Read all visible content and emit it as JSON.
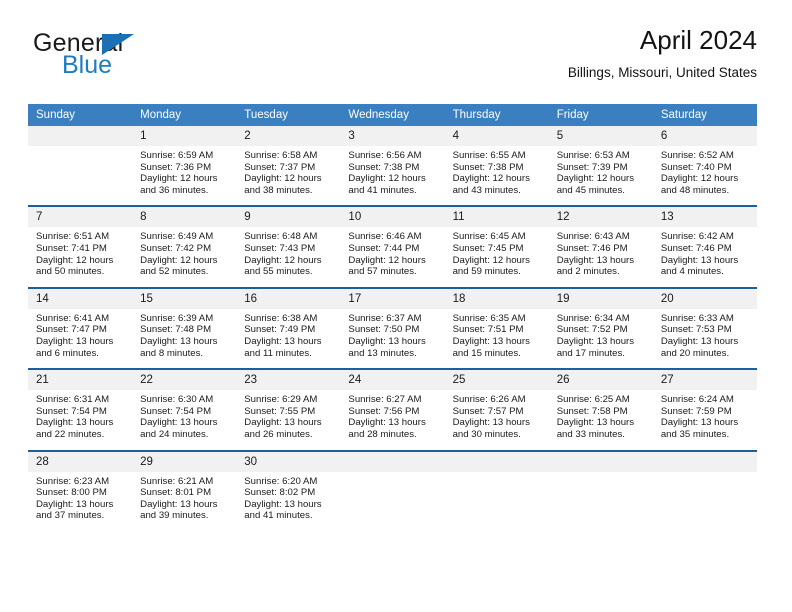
{
  "brand": {
    "name_top": "General",
    "name_bottom": "Blue",
    "triangle_color": "#1a6fb5",
    "blue_text_color": "#1c7cc1"
  },
  "header": {
    "title": "April 2024",
    "subtitle": "Billings, Missouri, United States"
  },
  "theme": {
    "header_blue": "#3a7fbf",
    "separator_blue": "#1a5fa0",
    "daynum_band": "#f1f1f1",
    "text": "#1b1b1b"
  },
  "calendar": {
    "weekday_headers": [
      "Sunday",
      "Monday",
      "Tuesday",
      "Wednesday",
      "Thursday",
      "Friday",
      "Saturday"
    ],
    "weeks": [
      [
        {
          "day": "",
          "lines": []
        },
        {
          "day": "1",
          "lines": [
            "Sunrise: 6:59 AM",
            "Sunset: 7:36 PM",
            "Daylight: 12 hours",
            "and 36 minutes."
          ]
        },
        {
          "day": "2",
          "lines": [
            "Sunrise: 6:58 AM",
            "Sunset: 7:37 PM",
            "Daylight: 12 hours",
            "and 38 minutes."
          ]
        },
        {
          "day": "3",
          "lines": [
            "Sunrise: 6:56 AM",
            "Sunset: 7:38 PM",
            "Daylight: 12 hours",
            "and 41 minutes."
          ]
        },
        {
          "day": "4",
          "lines": [
            "Sunrise: 6:55 AM",
            "Sunset: 7:38 PM",
            "Daylight: 12 hours",
            "and 43 minutes."
          ]
        },
        {
          "day": "5",
          "lines": [
            "Sunrise: 6:53 AM",
            "Sunset: 7:39 PM",
            "Daylight: 12 hours",
            "and 45 minutes."
          ]
        },
        {
          "day": "6",
          "lines": [
            "Sunrise: 6:52 AM",
            "Sunset: 7:40 PM",
            "Daylight: 12 hours",
            "and 48 minutes."
          ]
        }
      ],
      [
        {
          "day": "7",
          "lines": [
            "Sunrise: 6:51 AM",
            "Sunset: 7:41 PM",
            "Daylight: 12 hours",
            "and 50 minutes."
          ]
        },
        {
          "day": "8",
          "lines": [
            "Sunrise: 6:49 AM",
            "Sunset: 7:42 PM",
            "Daylight: 12 hours",
            "and 52 minutes."
          ]
        },
        {
          "day": "9",
          "lines": [
            "Sunrise: 6:48 AM",
            "Sunset: 7:43 PM",
            "Daylight: 12 hours",
            "and 55 minutes."
          ]
        },
        {
          "day": "10",
          "lines": [
            "Sunrise: 6:46 AM",
            "Sunset: 7:44 PM",
            "Daylight: 12 hours",
            "and 57 minutes."
          ]
        },
        {
          "day": "11",
          "lines": [
            "Sunrise: 6:45 AM",
            "Sunset: 7:45 PM",
            "Daylight: 12 hours",
            "and 59 minutes."
          ]
        },
        {
          "day": "12",
          "lines": [
            "Sunrise: 6:43 AM",
            "Sunset: 7:46 PM",
            "Daylight: 13 hours",
            "and 2 minutes."
          ]
        },
        {
          "day": "13",
          "lines": [
            "Sunrise: 6:42 AM",
            "Sunset: 7:46 PM",
            "Daylight: 13 hours",
            "and 4 minutes."
          ]
        }
      ],
      [
        {
          "day": "14",
          "lines": [
            "Sunrise: 6:41 AM",
            "Sunset: 7:47 PM",
            "Daylight: 13 hours",
            "and 6 minutes."
          ]
        },
        {
          "day": "15",
          "lines": [
            "Sunrise: 6:39 AM",
            "Sunset: 7:48 PM",
            "Daylight: 13 hours",
            "and 8 minutes."
          ]
        },
        {
          "day": "16",
          "lines": [
            "Sunrise: 6:38 AM",
            "Sunset: 7:49 PM",
            "Daylight: 13 hours",
            "and 11 minutes."
          ]
        },
        {
          "day": "17",
          "lines": [
            "Sunrise: 6:37 AM",
            "Sunset: 7:50 PM",
            "Daylight: 13 hours",
            "and 13 minutes."
          ]
        },
        {
          "day": "18",
          "lines": [
            "Sunrise: 6:35 AM",
            "Sunset: 7:51 PM",
            "Daylight: 13 hours",
            "and 15 minutes."
          ]
        },
        {
          "day": "19",
          "lines": [
            "Sunrise: 6:34 AM",
            "Sunset: 7:52 PM",
            "Daylight: 13 hours",
            "and 17 minutes."
          ]
        },
        {
          "day": "20",
          "lines": [
            "Sunrise: 6:33 AM",
            "Sunset: 7:53 PM",
            "Daylight: 13 hours",
            "and 20 minutes."
          ]
        }
      ],
      [
        {
          "day": "21",
          "lines": [
            "Sunrise: 6:31 AM",
            "Sunset: 7:54 PM",
            "Daylight: 13 hours",
            "and 22 minutes."
          ]
        },
        {
          "day": "22",
          "lines": [
            "Sunrise: 6:30 AM",
            "Sunset: 7:54 PM",
            "Daylight: 13 hours",
            "and 24 minutes."
          ]
        },
        {
          "day": "23",
          "lines": [
            "Sunrise: 6:29 AM",
            "Sunset: 7:55 PM",
            "Daylight: 13 hours",
            "and 26 minutes."
          ]
        },
        {
          "day": "24",
          "lines": [
            "Sunrise: 6:27 AM",
            "Sunset: 7:56 PM",
            "Daylight: 13 hours",
            "and 28 minutes."
          ]
        },
        {
          "day": "25",
          "lines": [
            "Sunrise: 6:26 AM",
            "Sunset: 7:57 PM",
            "Daylight: 13 hours",
            "and 30 minutes."
          ]
        },
        {
          "day": "26",
          "lines": [
            "Sunrise: 6:25 AM",
            "Sunset: 7:58 PM",
            "Daylight: 13 hours",
            "and 33 minutes."
          ]
        },
        {
          "day": "27",
          "lines": [
            "Sunrise: 6:24 AM",
            "Sunset: 7:59 PM",
            "Daylight: 13 hours",
            "and 35 minutes."
          ]
        }
      ],
      [
        {
          "day": "28",
          "lines": [
            "Sunrise: 6:23 AM",
            "Sunset: 8:00 PM",
            "Daylight: 13 hours",
            "and 37 minutes."
          ]
        },
        {
          "day": "29",
          "lines": [
            "Sunrise: 6:21 AM",
            "Sunset: 8:01 PM",
            "Daylight: 13 hours",
            "and 39 minutes."
          ]
        },
        {
          "day": "30",
          "lines": [
            "Sunrise: 6:20 AM",
            "Sunset: 8:02 PM",
            "Daylight: 13 hours",
            "and 41 minutes."
          ]
        },
        {
          "day": "",
          "lines": []
        },
        {
          "day": "",
          "lines": []
        },
        {
          "day": "",
          "lines": []
        },
        {
          "day": "",
          "lines": []
        }
      ]
    ]
  }
}
